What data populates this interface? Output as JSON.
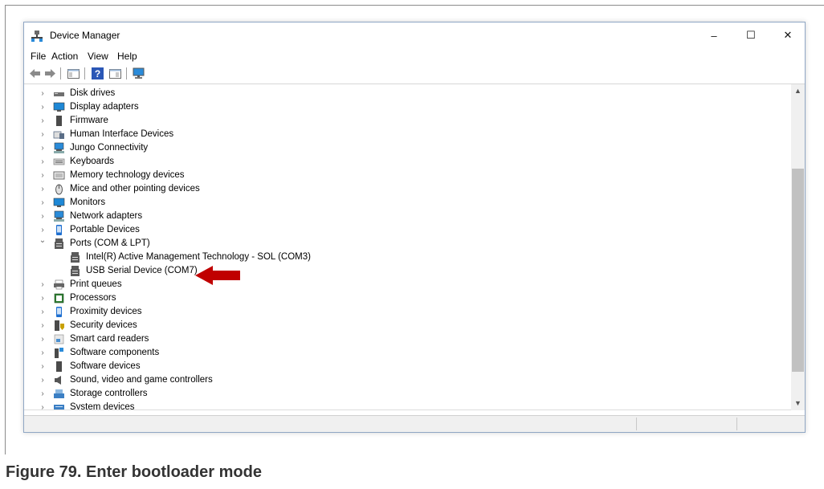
{
  "window": {
    "title": "Device Manager",
    "minimize": "–",
    "maximize": "☐",
    "close": "✕"
  },
  "menu": [
    "File",
    "Action",
    "View",
    "Help"
  ],
  "toolbar": [
    "back-icon",
    "forward-icon",
    "show-hide-console-tree-icon",
    "help-icon",
    "properties-icon",
    "scan-hardware-icon"
  ],
  "tree": [
    {
      "label": "Disk drives",
      "icon": "disk-icon",
      "color": "#6f6f6f",
      "level": 0,
      "state": "collapsed"
    },
    {
      "label": "Display adapters",
      "icon": "display-icon",
      "color": "#1e88d6",
      "level": 0,
      "state": "collapsed"
    },
    {
      "label": "Firmware",
      "icon": "firmware-icon",
      "color": "#4a4a4a",
      "level": 0,
      "state": "collapsed"
    },
    {
      "label": "Human Interface Devices",
      "icon": "hid-icon",
      "color": "#5a6d86",
      "level": 0,
      "state": "collapsed"
    },
    {
      "label": "Jungo Connectivity",
      "icon": "network-icon",
      "color": "#2a8bd9",
      "level": 0,
      "state": "collapsed"
    },
    {
      "label": "Keyboards",
      "icon": "keyboard-icon",
      "color": "#8a8a8a",
      "level": 0,
      "state": "collapsed"
    },
    {
      "label": "Memory technology devices",
      "icon": "memory-icon",
      "color": "#6b6b6b",
      "level": 0,
      "state": "collapsed"
    },
    {
      "label": "Mice and other pointing devices",
      "icon": "mouse-icon",
      "color": "#555555",
      "level": 0,
      "state": "collapsed"
    },
    {
      "label": "Monitors",
      "icon": "monitor-icon",
      "color": "#1e88d6",
      "level": 0,
      "state": "collapsed"
    },
    {
      "label": "Network adapters",
      "icon": "network-icon",
      "color": "#2a8bd9",
      "level": 0,
      "state": "collapsed"
    },
    {
      "label": "Portable Devices",
      "icon": "portable-icon",
      "color": "#1e6fd0",
      "level": 0,
      "state": "collapsed"
    },
    {
      "label": "Ports (COM & LPT)",
      "icon": "port-icon",
      "color": "#5a5a5a",
      "level": 0,
      "state": "expanded"
    },
    {
      "label": "Intel(R) Active Management Technology - SOL (COM3)",
      "icon": "port-icon",
      "color": "#5a5a5a",
      "level": 1,
      "state": "none"
    },
    {
      "label": "USB Serial Device (COM7)",
      "icon": "port-icon",
      "color": "#5a5a5a",
      "level": 1,
      "state": "none"
    },
    {
      "label": "Print queues",
      "icon": "printer-icon",
      "color": "#666666",
      "level": 0,
      "state": "collapsed"
    },
    {
      "label": "Processors",
      "icon": "processor-icon",
      "color": "#2f7d32",
      "level": 0,
      "state": "collapsed"
    },
    {
      "label": "Proximity devices",
      "icon": "proximity-icon",
      "color": "#1e6fd0",
      "level": 0,
      "state": "collapsed"
    },
    {
      "label": "Security devices",
      "icon": "security-icon",
      "color": "#c8a000",
      "level": 0,
      "state": "collapsed"
    },
    {
      "label": "Smart card readers",
      "icon": "smartcard-icon",
      "color": "#4a8fd0",
      "level": 0,
      "state": "collapsed"
    },
    {
      "label": "Software components",
      "icon": "software-component-icon",
      "color": "#4a4a4a",
      "level": 0,
      "state": "collapsed"
    },
    {
      "label": "Software devices",
      "icon": "software-device-icon",
      "color": "#4a4a4a",
      "level": 0,
      "state": "collapsed"
    },
    {
      "label": "Sound, video and game controllers",
      "icon": "sound-icon",
      "color": "#555555",
      "level": 0,
      "state": "collapsed"
    },
    {
      "label": "Storage controllers",
      "icon": "storage-icon",
      "color": "#3b7fc4",
      "level": 0,
      "state": "collapsed"
    },
    {
      "label": "System devices",
      "icon": "system-icon",
      "color": "#3b7fc4",
      "level": 0,
      "state": "collapsed"
    }
  ],
  "annotation": {
    "color": "#c00000",
    "target": "USB Serial Device (COM7)"
  },
  "caption": "Figure 79.   Enter bootloader mode"
}
